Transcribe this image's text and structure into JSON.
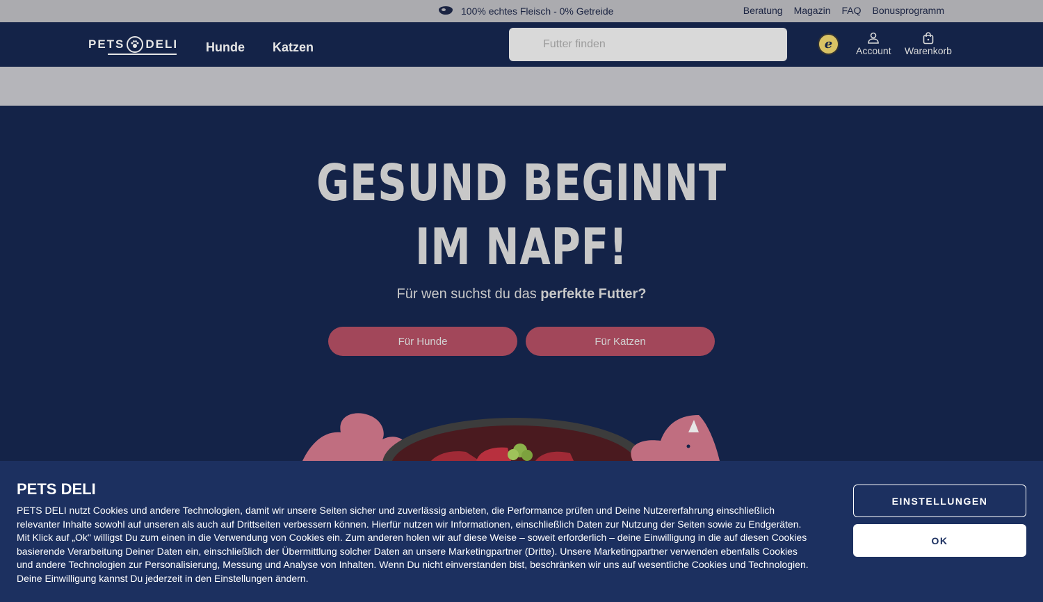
{
  "topbar": {
    "promo_icon": "steak-icon",
    "promo_text": "100% echtes Fleisch - 0% Getreide",
    "links": [
      "Beratung",
      "Magazin",
      "FAQ",
      "Bonusprogramm"
    ]
  },
  "header": {
    "logo_left": "PETS",
    "logo_right": "DELI",
    "nav": [
      "Hunde",
      "Katzen"
    ],
    "search_placeholder": "Futter finden",
    "trust_badge": "e",
    "account_label": "Account",
    "cart_label": "Warenkorb"
  },
  "hero": {
    "headline_line1": "GESUND BEGINNT",
    "headline_line2": "IM NAPF!",
    "sub_regular": "Für wen suchst du das ",
    "sub_bold": "perfekte Futter?",
    "btn_dogs": "Für Hunde",
    "btn_cats": "Für Katzen"
  },
  "cookie": {
    "title": "PETS DELI",
    "text": "PETS DELI nutzt Cookies und andere Technologien, damit wir unsere Seiten sicher und zuverlässig anbieten, die Performance prüfen und Deine Nutzererfahrung einschließlich relevanter Inhalte sowohl auf unseren als auch auf Drittseiten verbessern können. Hierfür nutzen wir Informationen, einschließlich Daten zur Nutzung der Seiten sowie zu Endgeräten. Mit Klick auf „Ok\" willigst Du zum einen in die Verwendung von Cookies ein. Zum anderen holen wir auf diese Weise – soweit erforderlich – deine Einwilligung in die auf diesen Cookies basierende Verarbeitung Deiner Daten ein, einschließlich der Übermittlung solcher Daten an unsere Marketingpartner (Dritte). Unsere Marketingpartner verwenden ebenfalls Cookies und andere Technologien zur Personalisierung, Messung und Analyse von Inhalten. Wenn Du nicht einverstanden bist, beschränken wir uns auf wesentliche Cookies und Technologien. Deine Einwilligung kannst Du jederzeit in den Einstellungen ändern.",
    "settings_label": "EINSTELLUNGEN",
    "ok_label": "OK"
  },
  "colors": {
    "navy": "#142348",
    "banner": "#1c3060",
    "cta": "#a2475a",
    "topbar": "#ababaf"
  }
}
